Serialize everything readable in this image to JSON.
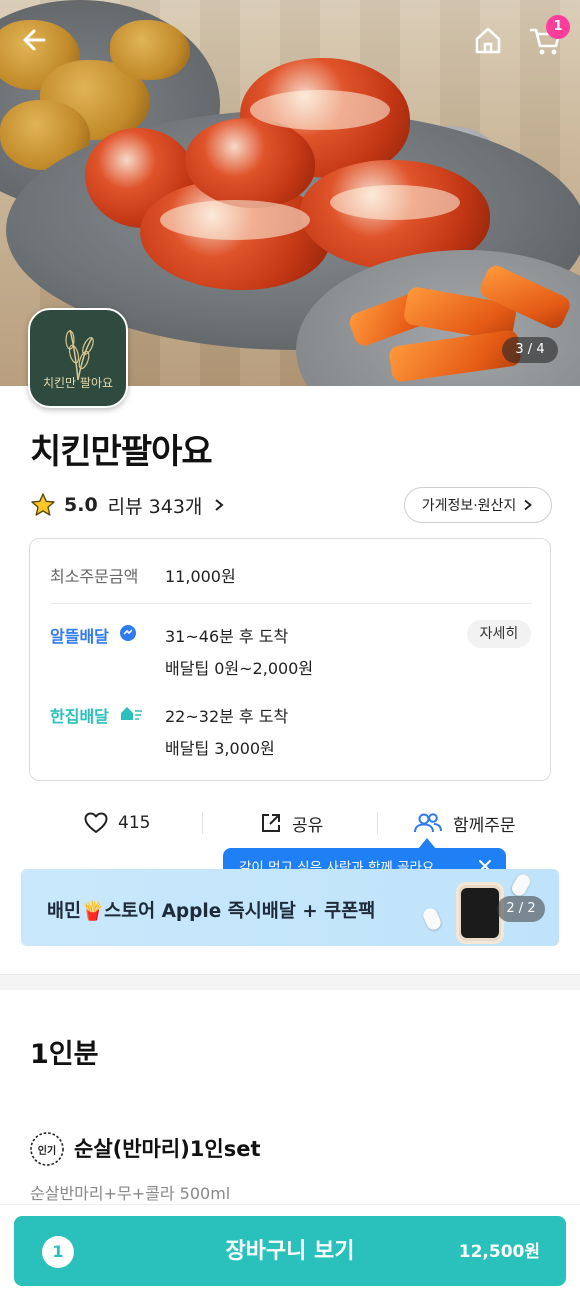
{
  "hero": {
    "image_counter": "3 / 4",
    "cart_badge": "1"
  },
  "store": {
    "logo_text": "치킨만 팔아요",
    "name": "치킨만팔아요",
    "rating": "5.0",
    "review_text": "리뷰 343개",
    "info_button_label": "가게정보·원산지"
  },
  "info_box": {
    "min_order_label": "최소주문금액",
    "min_order_value": "11,000원",
    "altteul": {
      "label": "알뜰배달",
      "eta": "31~46분 후 도착",
      "tip": "배달팁 0원~2,000원",
      "detail_button": "자세히"
    },
    "hanjip": {
      "label": "한집배달",
      "eta": "22~32분 후 도착",
      "tip": "배달팁 3,000원"
    }
  },
  "actions": {
    "like_count": "415",
    "share_label": "공유",
    "group_order_label": "함께주문"
  },
  "tooltip": {
    "text": "같이 먹고 싶은 사람과 함께 골라요"
  },
  "banner": {
    "text": "배민🍟스토어 Apple 즉시배달 + 쿠폰팩",
    "counter": "2 / 2"
  },
  "menu": {
    "section_title": "1인분",
    "badge": "인기",
    "item_name": "순살(반마리)1인set",
    "item_desc": "순살반마리+무+콜라 500ml"
  },
  "cart": {
    "count": "1",
    "label": "장바구니 보기",
    "total": "12,500원"
  },
  "colors": {
    "brand_mint": "#2ac1bc",
    "altteul_blue": "#2f7bf0",
    "badge_pink": "#ff3d9a",
    "tooltip_blue": "#1f80f5"
  },
  "icons": [
    "back-arrow-icon",
    "home-icon",
    "cart-icon",
    "star-icon",
    "chevron-right-icon",
    "heart-icon",
    "share-icon",
    "group-icon",
    "close-icon",
    "popular-badge-icon"
  ]
}
